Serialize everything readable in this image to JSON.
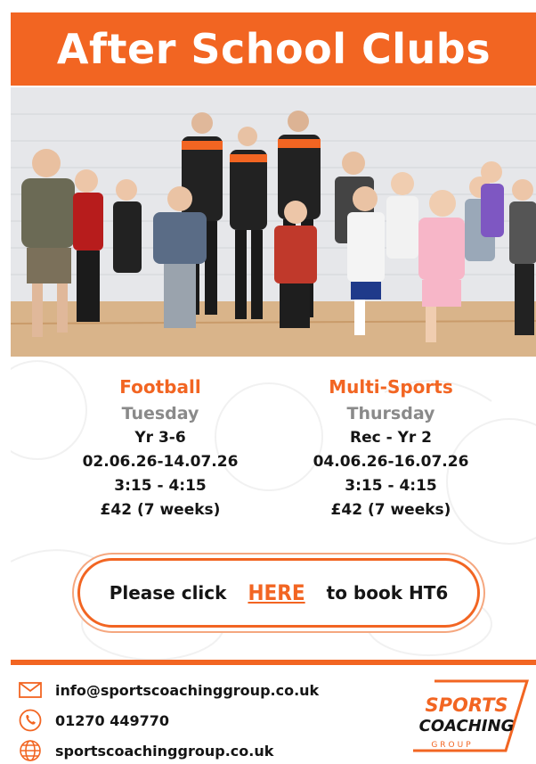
{
  "header": {
    "title": "After School Clubs"
  },
  "clubs": [
    {
      "name": "Football",
      "day": "Tuesday",
      "year": "Yr 3-6",
      "dates": "02.06.26-14.07.26",
      "time": "3:15 - 4:15",
      "price": "£42 (7 weeks)"
    },
    {
      "name": "Multi-Sports",
      "day": "Thursday",
      "year": "Rec - Yr 2",
      "dates": "04.06.26-16.07.26",
      "time": "3:15 - 4:15",
      "price": "£42 (7 weeks)"
    }
  ],
  "booking": {
    "prefix": "Please click",
    "link": "HERE",
    "suffix": "to book HT6"
  },
  "contact": {
    "email": "info@sportscoachinggroup.co.uk",
    "phone": "01270 449770",
    "website": "sportscoachinggroup.co.uk"
  },
  "logo": {
    "line1": "SPORTS",
    "line2": "COACHING",
    "line3": "GROUP"
  },
  "colors": {
    "accent": "#f26522",
    "text": "#151515",
    "muted": "#8a8a8a"
  }
}
